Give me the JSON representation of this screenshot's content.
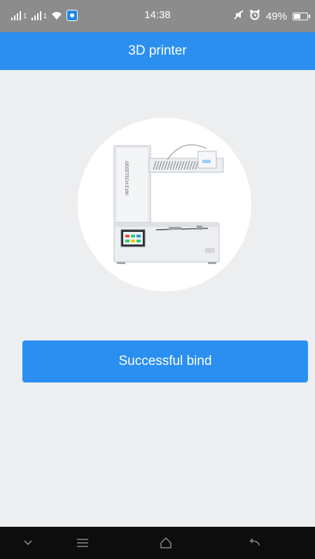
{
  "status_bar": {
    "signal_1_label": "1",
    "signal_2_label": "1",
    "time": "14:38",
    "battery_percent": "49%"
  },
  "header": {
    "title": "3D printer"
  },
  "printer_image": {
    "device_brand_label": "GEEETECH E180",
    "icon": "3d-printer-illustration"
  },
  "main": {
    "bind_button_label": "Successful bind"
  },
  "nav_bar": {
    "items": [
      "chevron-down-icon",
      "menu-icon",
      "home-icon",
      "back-icon"
    ]
  },
  "colors": {
    "accent": "#2b8ff0",
    "background": "#eceef0",
    "status_bar": "#8c8c8c",
    "nav_bar": "#0d0d0d"
  }
}
